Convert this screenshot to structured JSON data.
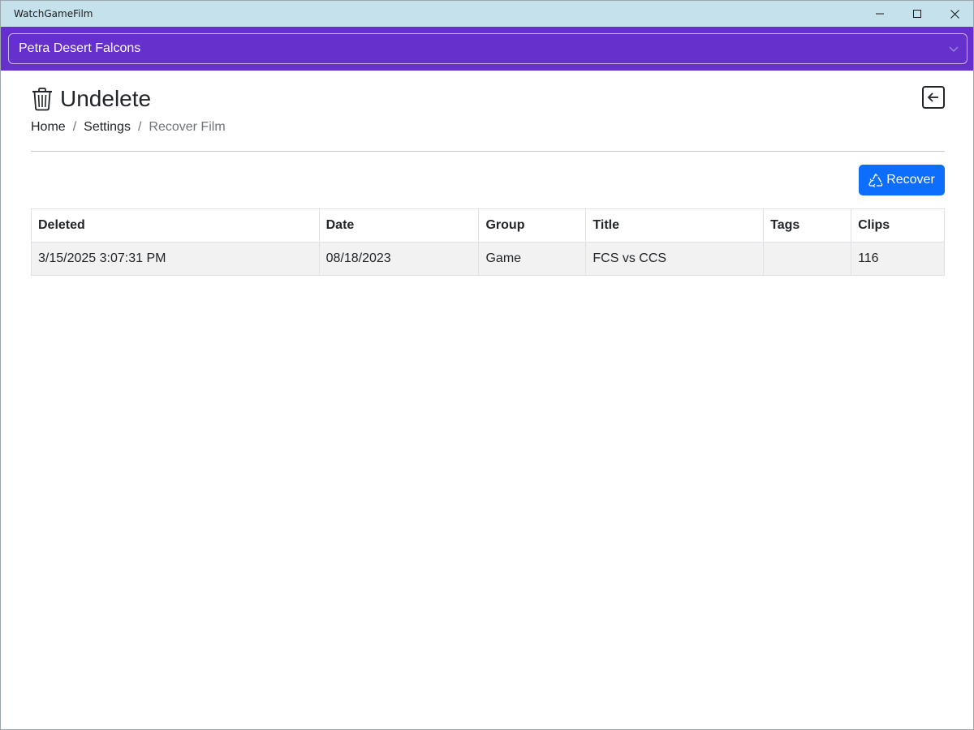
{
  "window": {
    "title": "WatchGameFilm",
    "minimize_icon": "minimize-icon",
    "maximize_icon": "maximize-icon",
    "close_icon": "close-icon"
  },
  "team_selector": {
    "selected": "Petra Desert Falcons",
    "icon": "chevron-down-icon",
    "bar_color": "#6530cb"
  },
  "page": {
    "title": "Undelete",
    "title_icon": "trash-icon",
    "back_icon": "arrow-left-square-icon"
  },
  "breadcrumb": {
    "home": "Home",
    "settings": "Settings",
    "current": "Recover Film",
    "separator": "/"
  },
  "actions": {
    "recover_label": "Recover",
    "recover_icon": "recycle-icon",
    "recover_color": "#0d6efd"
  },
  "table": {
    "headers": [
      "Deleted",
      "Date",
      "Group",
      "Title",
      "Tags",
      "Clips"
    ],
    "rows": [
      [
        "3/15/2025 3:07:31 PM",
        "08/18/2023",
        "Game",
        "FCS vs CCS",
        "",
        "116"
      ]
    ]
  }
}
